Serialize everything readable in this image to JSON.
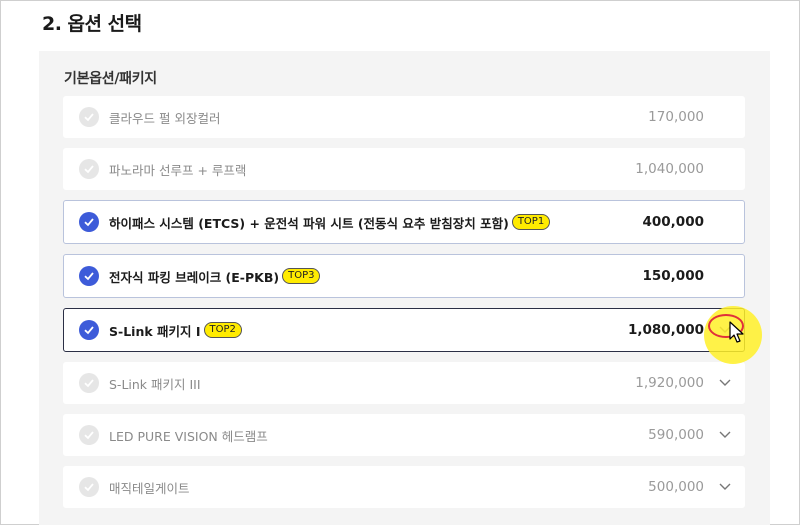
{
  "section": {
    "title": "2. 옵션 선택"
  },
  "panel": {
    "title": "기본옵션/패키지"
  },
  "options": [
    {
      "label": "클라우드 펄 외장컬러",
      "price": "170,000",
      "selected": false,
      "expandable": false
    },
    {
      "label": "파노라마 선루프 + 루프랙",
      "price": "1,040,000",
      "selected": false,
      "expandable": false
    },
    {
      "label": "하이패스 시스템 (ETCS) + 운전석 파워 시트 (전동식 요추 받침장치 포함)",
      "badge": "TOP1",
      "price": "400,000",
      "selected": true,
      "expandable": false
    },
    {
      "label": "전자식 파킹 브레이크 (E-PKB)",
      "badge": "TOP3",
      "price": "150,000",
      "selected": true,
      "expandable": false
    },
    {
      "label": "S-Link 패키지 I",
      "badge": "TOP2",
      "price": "1,080,000",
      "selected": true,
      "expandable": true
    },
    {
      "label": "S-Link 패키지 III",
      "price": "1,920,000",
      "selected": false,
      "expandable": true
    },
    {
      "label": "LED PURE VISION 헤드램프",
      "price": "590,000",
      "selected": false,
      "expandable": true
    },
    {
      "label": "매직테일게이트",
      "price": "500,000",
      "selected": false,
      "expandable": true
    }
  ],
  "colors": {
    "accent": "#3d5bd9",
    "badge": "#ffeb00",
    "panel": "#f4f4f4"
  },
  "icons": {
    "check": "check-icon",
    "expand": "chevron-down-icon",
    "cursor": "mouse-pointer-icon"
  }
}
